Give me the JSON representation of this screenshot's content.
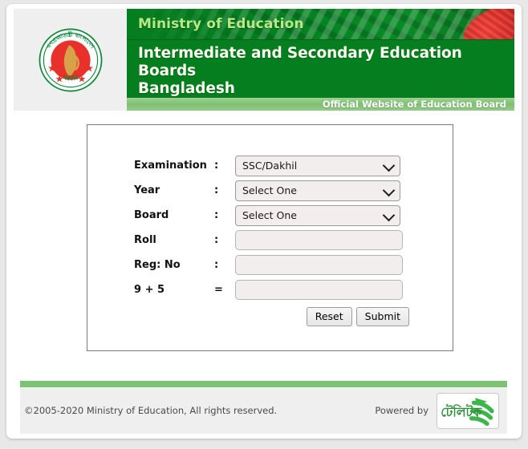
{
  "header": {
    "emblem_alt": "Government of Bangladesh national emblem",
    "ministry": "Ministry of Education",
    "title_line1": "Intermediate and Secondary Education Boards",
    "title_line2": "Bangladesh",
    "official_tagline": "Official Website of Education Board"
  },
  "form": {
    "rows": [
      {
        "label": "Examination",
        "separator": ":",
        "type": "select",
        "value": "SSC/Dakhil"
      },
      {
        "label": "Year",
        "separator": ":",
        "type": "select",
        "value": "Select One"
      },
      {
        "label": "Board",
        "separator": ":",
        "type": "select",
        "value": "Select One"
      },
      {
        "label": "Roll",
        "separator": ":",
        "type": "text",
        "value": ""
      },
      {
        "label": "Reg: No",
        "separator": ":",
        "type": "text",
        "value": ""
      },
      {
        "label": "9 + 5",
        "separator": "=",
        "type": "text",
        "value": ""
      }
    ],
    "examination_options": [
      "SSC/Dakhil"
    ],
    "year_options": [
      "Select One"
    ],
    "board_options": [
      "Select One"
    ],
    "reset_label": "Reset",
    "submit_label": "Submit"
  },
  "footer": {
    "copyright": "©2005-2020 Ministry of Education, All rights reserved.",
    "powered_by": "Powered by",
    "teletalk_logo_text": "টেলিটক"
  },
  "colors": {
    "banner_green": "#047e1f",
    "ministry_text": "#b8e986",
    "tagline_bar": "#7fbf72",
    "footer_rule": "#7ac471",
    "field_fill": "#f2eeee",
    "flag_red": "#da2a23"
  }
}
